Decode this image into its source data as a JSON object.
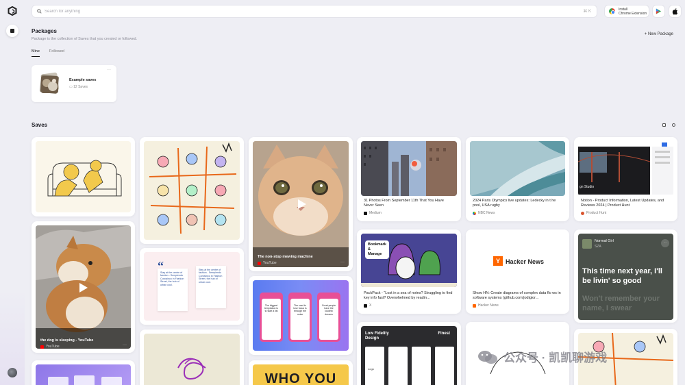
{
  "search": {
    "placeholder": "Search for anything",
    "shortcut": "⌘ K"
  },
  "extension": {
    "line1": "Install",
    "line2": "Chrome Extension"
  },
  "packages": {
    "title": "Packages",
    "subtitle": "Package is the collection of Saves that you created or followed.",
    "new_label": "+  New Package",
    "tabs": [
      "Mine",
      "Followed"
    ],
    "items": [
      {
        "name": "Example saves",
        "count": "12 Saves"
      }
    ]
  },
  "saves": {
    "title": "Saves",
    "cards": [
      {
        "overlay_title": "the dog is sleeping - YouTube",
        "source": "YouTube"
      },
      {
        "overlay_title": "The non-stop mewing machine",
        "source": "YouTube"
      },
      {
        "title": "31 Photos From September 11th That You Have Never Seen",
        "source": "Medium"
      },
      {
        "title": "PackPack - \"Lost in a sea of notes? Struggling to find key info fast? Overwhelmed by readin...",
        "source": "X"
      },
      {
        "image_label": "Low Fidelity Design",
        "image_label2": "Finest",
        "image_label3": "Logo"
      },
      {
        "title": "2024 Paris Olympics live updates: Ledecky in t he pool, USA rugby",
        "source": "NBC News"
      },
      {
        "title": "Show HN: Create diagrams of complex data flo ws in software systems (github.com/jodigior...",
        "source": "Hacker News",
        "image_label": "Hacker News"
      },
      {
        "title": "Notion - Product Information, Latest Updates, and Reviews 2024 | Product Hunt",
        "source": "Product Hunt",
        "image_label": "gn Studio"
      },
      {
        "user": "Normal Girl",
        "handle": "SZA",
        "lyric": "This time next year, I'll be livin' so good",
        "lyric_faded": "Won't remember your name, I swear"
      },
      {
        "quote_text": "Stay at the centre of fashion - Sempiendo Corcisinco in Fashion Street, the hub of urban cool."
      },
      {
        "phone1": "The biggest temptation is to start a list",
        "phone2": "The road to lose focus is through the noise",
        "phone3": "Great people have the loudest dreams"
      },
      {
        "banner": "WHO YOU"
      },
      {
        "bubble1": "Bookmark",
        "bubble2": "&",
        "bubble3": "Manage"
      }
    ]
  },
  "watermark": {
    "text": "公众号 · 凯凯聊游戏"
  },
  "colors": {
    "youtube": "#ff0000",
    "hacker_news": "#ff6600",
    "product_hunt": "#da552f",
    "accent_purple": "#8b6cf0"
  }
}
